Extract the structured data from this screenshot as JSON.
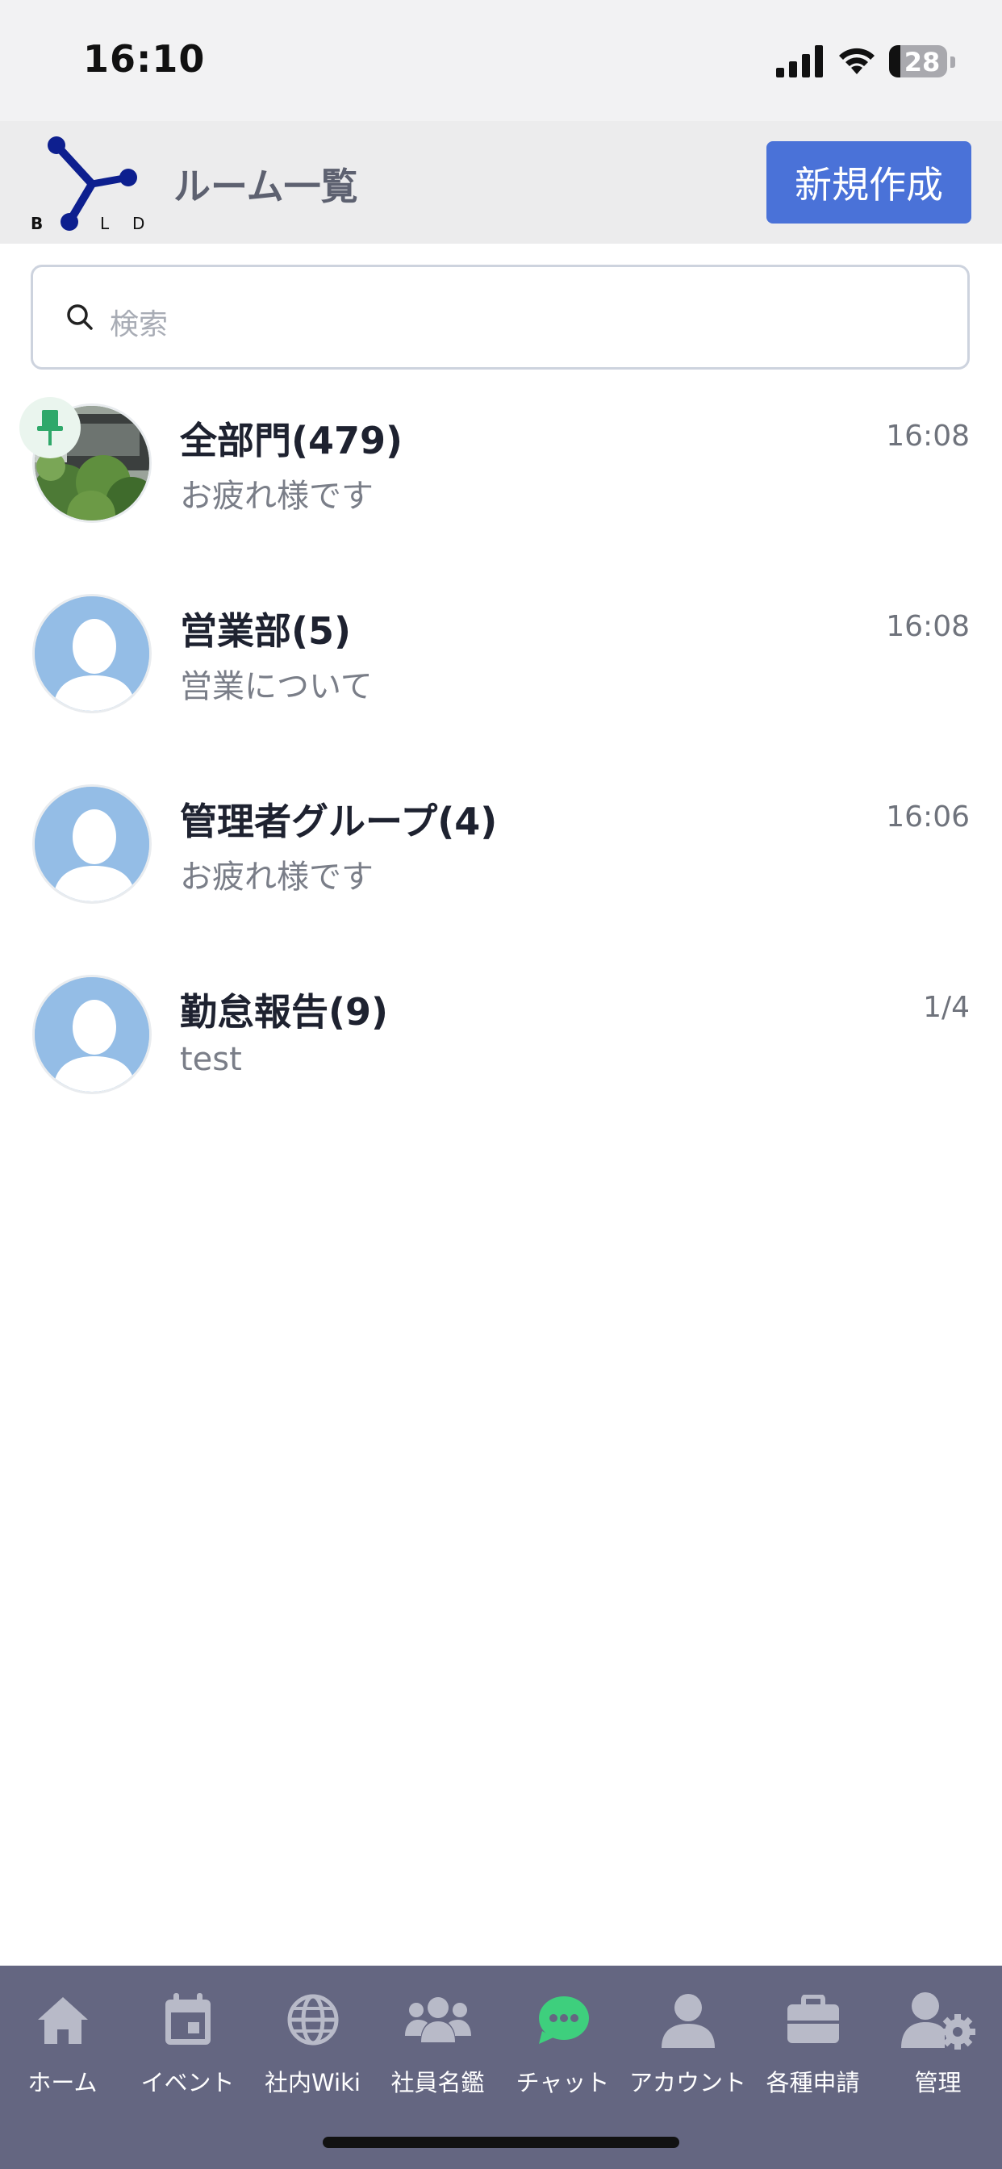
{
  "status_bar": {
    "time": "16:10",
    "battery": "28"
  },
  "header": {
    "logo_text": [
      "B",
      "L",
      "D"
    ],
    "title": "ルーム一覧",
    "new_button_label": "新規作成",
    "logo_color": "#0d1f8f"
  },
  "search": {
    "placeholder": "検索"
  },
  "rooms": [
    {
      "name": "全部門(479)",
      "preview": "お疲れ様です",
      "time": "16:08",
      "pinned": true,
      "avatar": "photo"
    },
    {
      "name": "営業部(5)",
      "preview": "営業について",
      "time": "16:08",
      "pinned": false,
      "avatar": "default-person"
    },
    {
      "name": "管理者グループ(4)",
      "preview": "お疲れ様です",
      "time": "16:06",
      "pinned": false,
      "avatar": "default-person"
    },
    {
      "name": "勤怠報告(9)",
      "preview": "test",
      "time": "1/4",
      "pinned": false,
      "avatar": "default-person"
    }
  ],
  "bottom_nav": {
    "items": [
      {
        "label": "ホーム",
        "icon": "home-icon"
      },
      {
        "label": "イベント",
        "icon": "calendar-icon"
      },
      {
        "label": "社内Wiki",
        "icon": "globe-icon"
      },
      {
        "label": "社員名鑑",
        "icon": "users-icon"
      },
      {
        "label": "チャット",
        "icon": "chat-icon",
        "active": true
      },
      {
        "label": "アカウント",
        "icon": "user-icon"
      },
      {
        "label": "各種申請",
        "icon": "briefcase-icon"
      },
      {
        "label": "管理",
        "icon": "user-gear-icon"
      }
    ],
    "active_color": "#3ecf7d",
    "icon_color": "#b8bac8"
  },
  "colors": {
    "accent": "#4a72d8",
    "pin": "#2fa86a"
  }
}
